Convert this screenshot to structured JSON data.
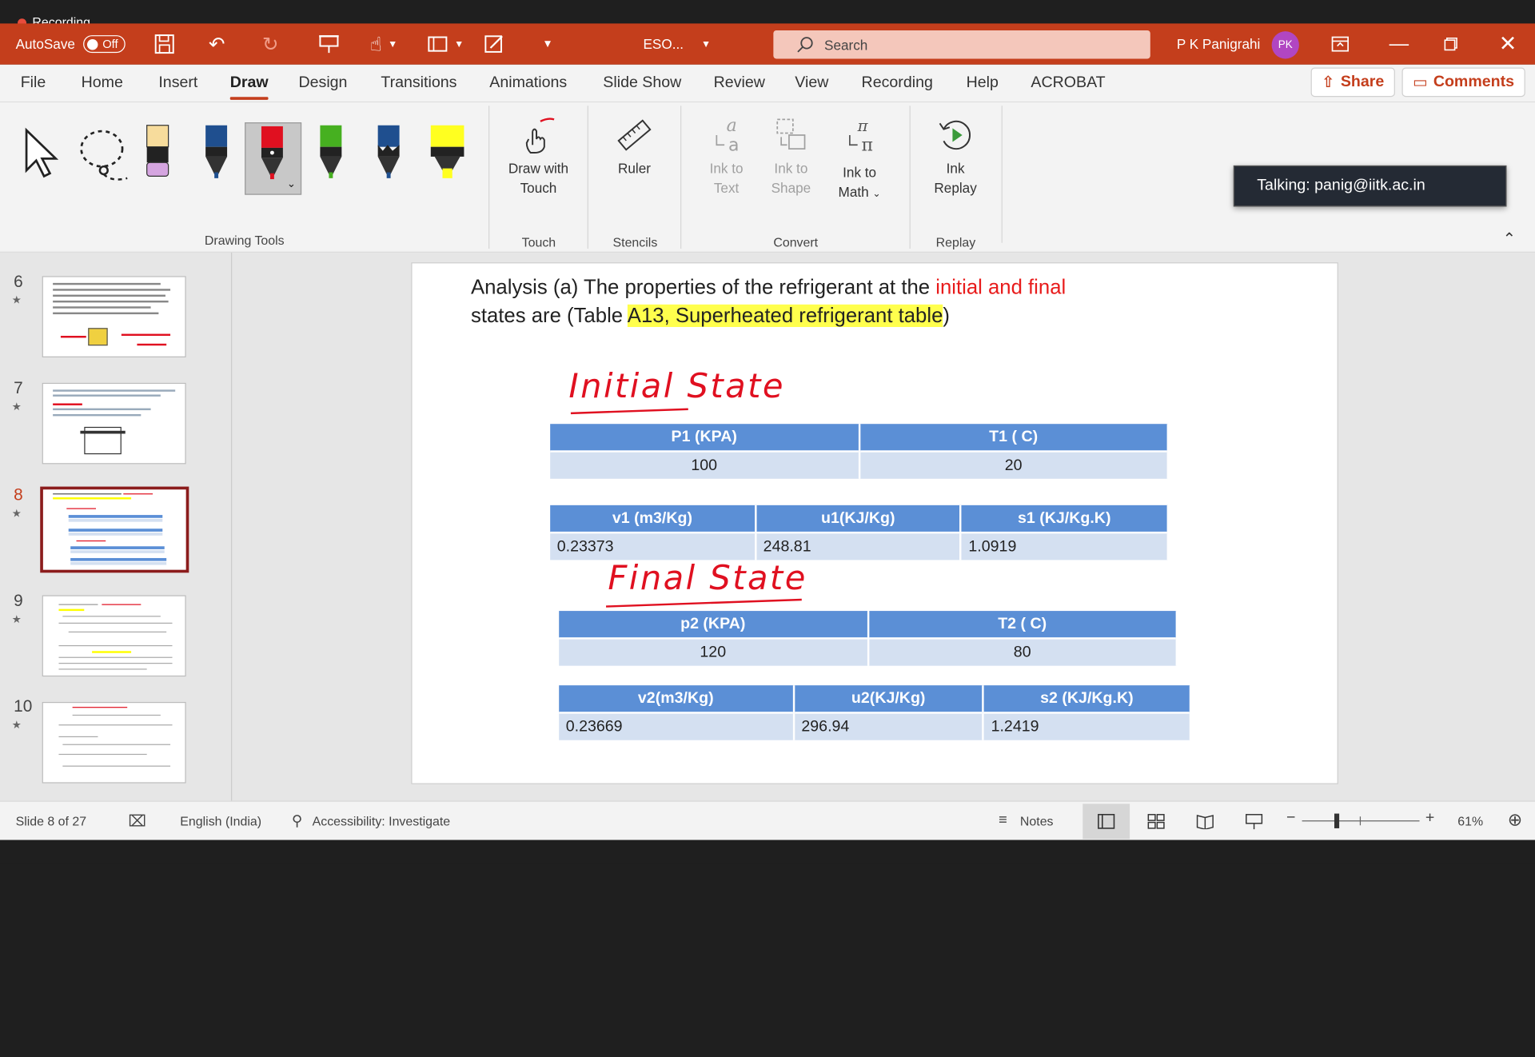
{
  "recording": {
    "label": "Recording"
  },
  "titlebar": {
    "autosave_label": "AutoSave",
    "autosave_state": "Off",
    "filename": "ESO...",
    "search_placeholder": "Search",
    "user_name": "P K Panigrahi",
    "user_initials": "PK"
  },
  "menu": {
    "tabs": [
      "File",
      "Home",
      "Insert",
      "Draw",
      "Design",
      "Transitions",
      "Animations",
      "Slide Show",
      "Review",
      "View",
      "Recording",
      "Help",
      "ACROBAT"
    ],
    "active_tab": "Draw",
    "share_label": "Share",
    "comments_label": "Comments"
  },
  "ribbon": {
    "groups": {
      "drawing_tools": "Drawing Tools",
      "touch": "Touch",
      "stencils": "Stencils",
      "convert": "Convert",
      "replay": "Replay"
    },
    "draw_with_touch": [
      "Draw with",
      "Touch"
    ],
    "ruler": "Ruler",
    "ink_to_text": [
      "Ink to",
      "Text"
    ],
    "ink_to_shape": [
      "Ink to",
      "Shape"
    ],
    "ink_to_math": [
      "Ink to",
      "Math"
    ],
    "ink_replay": [
      "Ink",
      "Replay"
    ]
  },
  "tooltip": {
    "text": "Talking: panig@iitk.ac.in"
  },
  "thumbnails": {
    "slides": [
      {
        "number": "6",
        "star": "★"
      },
      {
        "number": "7",
        "star": "★"
      },
      {
        "number": "8",
        "star": "★"
      },
      {
        "number": "9",
        "star": "★"
      },
      {
        "number": "10",
        "star": "★"
      }
    ],
    "active": "8"
  },
  "slide": {
    "heading_part1": "Analysis (a) The properties of the refrigerant at the ",
    "heading_red": "initial and final",
    "heading_part2": "states are (Table ",
    "heading_highlight": "A13, Superheated refrigerant table",
    "heading_end": ")",
    "initial_label": "Initial State",
    "final_label": "Final State",
    "table_initial_1": {
      "headers": [
        "P1 (KPA)",
        "T1 (  C)"
      ],
      "values": [
        "100",
        "20"
      ]
    },
    "table_initial_2": {
      "headers": [
        "v1 (m3/Kg)",
        "u1(KJ/Kg)",
        "s1 (KJ/Kg.K)"
      ],
      "values": [
        "0.23373",
        "248.81",
        "1.0919"
      ]
    },
    "table_final_1": {
      "headers": [
        "p2 (KPA)",
        "T2 (  C)"
      ],
      "values": [
        "120",
        "80"
      ]
    },
    "table_final_2": {
      "headers": [
        "v2(m3/Kg)",
        "u2(KJ/Kg)",
        "s2 (KJ/Kg.K)"
      ],
      "values": [
        "0.23669",
        "296.94",
        "1.2419"
      ]
    }
  },
  "status": {
    "slide_info": "Slide 8 of 27",
    "language": "English (India)",
    "accessibility": "Accessibility: Investigate",
    "notes": "Notes",
    "zoom": "61%",
    "zoom_minus": "−",
    "zoom_plus": "+"
  },
  "colors": {
    "accent": "#c43e1c",
    "table_header": "#5b8fd6",
    "table_cell": "#d4e0f1",
    "ink_red": "#e01020"
  }
}
